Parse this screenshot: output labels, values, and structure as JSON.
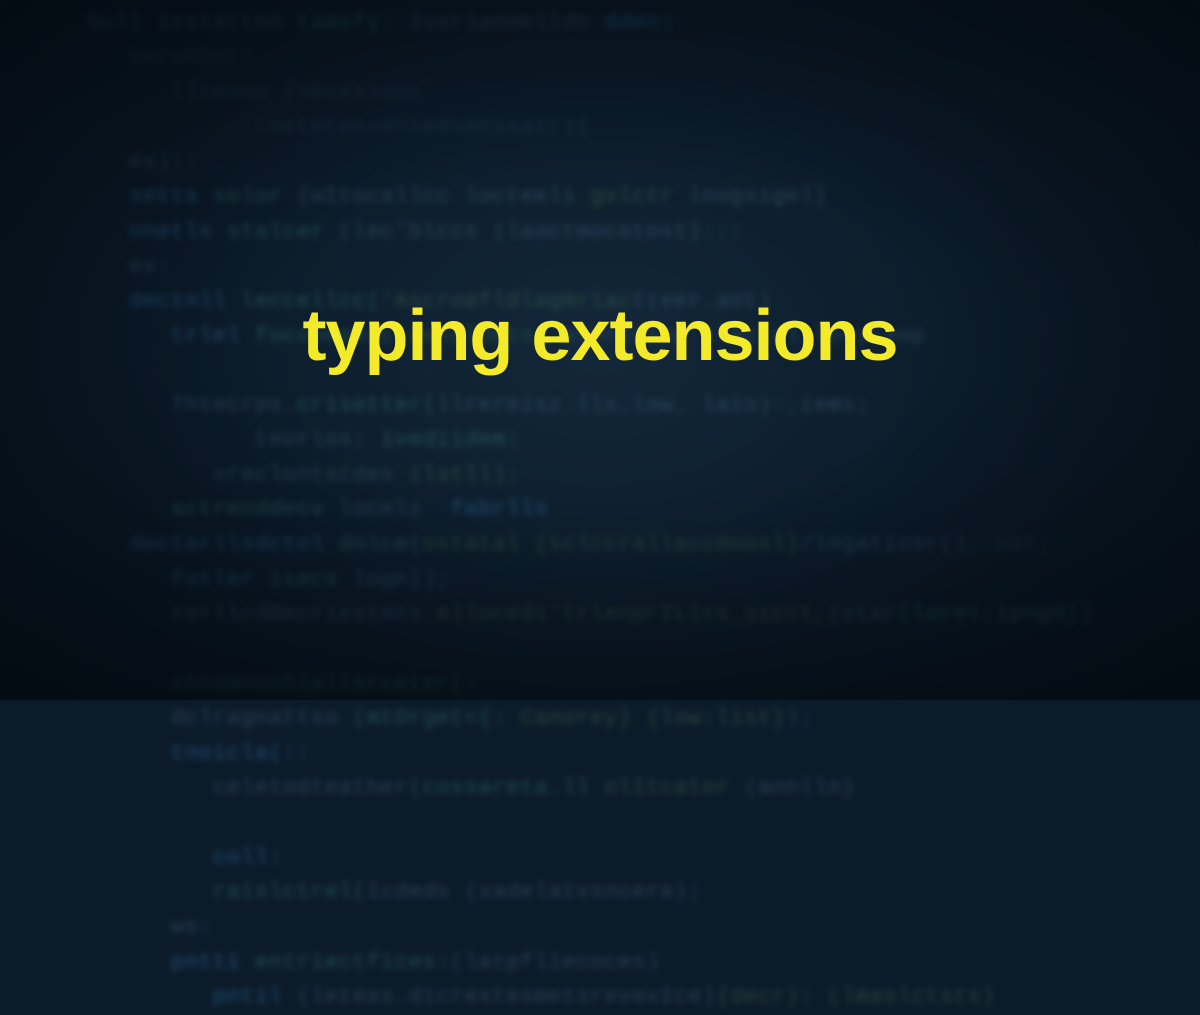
{
  "headline": "typing extensions",
  "code_lines": [
    {
      "indent": 0,
      "tokens": [
        {
          "t": "Null ",
          "c": "kw"
        },
        {
          "t": "Iestatton ",
          "c": "nm"
        },
        {
          "t": "tamsfy: ",
          "c": "fn"
        },
        {
          "t": "Iverlandelldn ",
          "c": "nm"
        },
        {
          "t": "dden",
          "c": "kw"
        },
        {
          "t": ")",
          "c": "op"
        }
      ]
    },
    {
      "indent": 1,
      "tokens": [
        {
          "t": "worehDot:",
          "c": "cm"
        }
      ]
    },
    {
      "indent": 2,
      "tokens": [
        {
          "t": "lItesms (omvesioms:",
          "c": "cm"
        }
      ]
    },
    {
      "indent": 4,
      "tokens": [
        {
          "t": "coeteteesensedsenssat(){",
          "c": "cm"
        }
      ]
    },
    {
      "indent": 1,
      "tokens": [
        {
          "t": "es):",
          "c": "nm"
        },
        {
          "t": ":",
          "c": "op"
        }
      ]
    },
    {
      "indent": 1,
      "tokens": [
        {
          "t": "setts ",
          "c": "kw"
        },
        {
          "t": "solor ",
          "c": "fn"
        },
        {
          "t": "{wItocallcc locteeli ",
          "c": "nm"
        },
        {
          "t": "gvlctr ",
          "c": "st"
        },
        {
          "t": "lnogsigel}",
          "c": "nm"
        }
      ]
    },
    {
      "indent": 1,
      "tokens": [
        {
          "t": "nnetls ",
          "c": "kw"
        },
        {
          "t": "stalcer ",
          "c": "fn"
        },
        {
          "t": "(lec'blccs (laactmocatost}",
          "c": "nm"
        },
        {
          "t": ";;;",
          "c": "op"
        }
      ]
    },
    {
      "indent": 1,
      "tokens": [
        {
          "t": "es:",
          "c": "nm"
        }
      ]
    },
    {
      "indent": 1,
      "tokens": [
        {
          "t": "dectnll ",
          "c": "kw"
        },
        {
          "t": "leccellcc(",
          "c": "fn"
        },
        {
          "t": "'Ascroafldlagmriac",
          "c": "st"
        },
        {
          "t": "t(eer.aot)",
          "c": "nm"
        }
      ]
    },
    {
      "indent": 2,
      "tokens": [
        {
          "t": "trlel ",
          "c": "kw"
        },
        {
          "t": "focopoposc(",
          "c": "fn"
        },
        {
          "t": "delclOOcs: ",
          "c": "st"
        },
        {
          "t": "aterlnioe llacisl lorycaop",
          "c": "nm"
        }
      ]
    },
    {
      "indent": 1,
      "tokens": [
        {
          "t": "",
          "c": "nm"
        }
      ]
    },
    {
      "indent": 2,
      "tokens": [
        {
          "t": "Thtecrps.",
          "c": "nm"
        },
        {
          "t": "crisetter(",
          "c": "fn"
        },
        {
          "t": "llrereisz lls.low. laio):,iems;",
          "c": "nm"
        }
      ]
    },
    {
      "indent": 4,
      "tokens": [
        {
          "t": "teorlos; ",
          "c": "nm"
        },
        {
          "t": "ivediidem:",
          "c": "fn"
        }
      ]
    },
    {
      "indent": 3,
      "tokens": [
        {
          "t": "sreclontscdes ",
          "c": "nm"
        },
        {
          "t": "ilstll):",
          "c": "st"
        }
      ]
    },
    {
      "indent": 2,
      "tokens": [
        {
          "t": "actrenddecv ",
          "c": "fn"
        },
        {
          "t": "locels  ",
          "c": "nm"
        },
        {
          "t": "fabrlls",
          "c": "kw"
        }
      ]
    },
    {
      "indent": 1,
      "tokens": [
        {
          "t": "dectarllsdctol ",
          "c": "kw"
        },
        {
          "t": "dolce(",
          "c": "fn"
        },
        {
          "t": "ostatal {sclccrallaccdoosl}",
          "c": "st"
        },
        {
          "t": "/logaticor(),",
          "c": "nm"
        },
        {
          "t": ".est;",
          "c": "cm"
        }
      ]
    },
    {
      "indent": 2,
      "tokens": [
        {
          "t": "fotler ",
          "c": "kw"
        },
        {
          "t": "isecs ",
          "c": "fn"
        },
        {
          "t": "logn});",
          "c": "nm"
        }
      ]
    },
    {
      "indent": 2,
      "tokens": [
        {
          "t": "rerllcdBecriestens ",
          "c": "nm"
        },
        {
          "t": "ellocedi'trlenprILics_sicct,",
          "c": "st"
        },
        {
          "t": "{otar",
          "c": "nm"
        },
        {
          "t": "(loret;ipngd})",
          "c": "fn"
        }
      ]
    },
    {
      "indent": 1,
      "tokens": [
        {
          "t": "",
          "c": "nm"
        }
      ]
    },
    {
      "indent": 2,
      "tokens": [
        {
          "t": "xtnamnsshiallsrceter(:",
          "c": "fn"
        }
      ]
    },
    {
      "indent": 2,
      "tokens": [
        {
          "t": "dclragnattso ",
          "c": "nm"
        },
        {
          "t": "(mtOrget<{: ",
          "c": "fn"
        },
        {
          "t": "Canorey} {low:list}",
          "c": "st"
        },
        {
          "t": ");",
          "c": "op"
        }
      ]
    },
    {
      "indent": 2,
      "tokens": [
        {
          "t": "tnoicla(::",
          "c": "kw"
        }
      ]
    },
    {
      "indent": 3,
      "tokens": [
        {
          "t": "celetodteather",
          "c": "nm"
        },
        {
          "t": "(cossareta.ll ",
          "c": "fn"
        },
        {
          "t": "olItcator",
          "c": "st"
        },
        {
          "t": " (annlln}",
          "c": "nm"
        }
      ]
    },
    {
      "indent": 1,
      "tokens": [
        {
          "t": "",
          "c": "nm"
        }
      ]
    },
    {
      "indent": 3,
      "tokens": [
        {
          "t": "coll:",
          "c": "kw"
        }
      ]
    },
    {
      "indent": 3,
      "tokens": [
        {
          "t": "raislctrel(",
          "c": "fn"
        },
        {
          "t": "Icdeds (sadelatvsncera);",
          "c": "nm"
        }
      ]
    },
    {
      "indent": 2,
      "tokens": [
        {
          "t": "ws:",
          "c": "nm"
        }
      ]
    },
    {
      "indent": 2,
      "tokens": [
        {
          "t": "pntti ",
          "c": "kw"
        },
        {
          "t": "entriectfices:",
          "c": "fn"
        },
        {
          "t": "(latpfliecoces)",
          "c": "nm"
        }
      ]
    },
    {
      "indent": 3,
      "tokens": [
        {
          "t": "pntil ",
          "c": "kw"
        },
        {
          "t": "(leteas.dicrestesmetsrevevIce)",
          "c": "nm"
        },
        {
          "t": "{decr): (lmaslctsts)",
          "c": "st"
        }
      ]
    }
  ]
}
